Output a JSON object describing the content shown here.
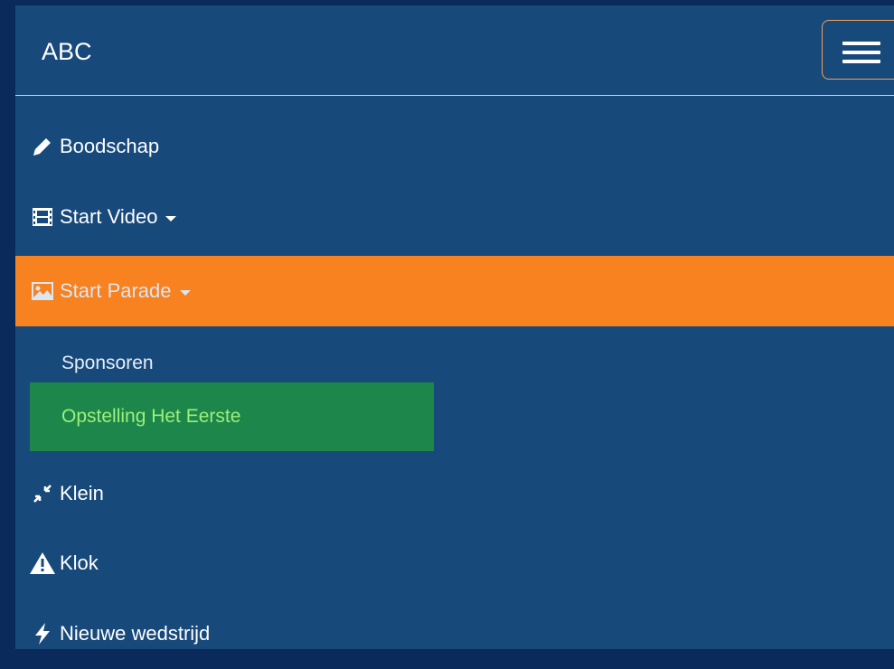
{
  "brand": {
    "title": "ABC"
  },
  "toggle": {
    "icon": "hamburger-icon"
  },
  "menu": {
    "items": [
      {
        "label": "Boodschap",
        "icon": "pencil-icon"
      },
      {
        "label": "Start Video",
        "icon": "film-icon",
        "dropdown": true
      },
      {
        "label": "Start Parade",
        "icon": "image-icon",
        "dropdown": true,
        "active": true
      },
      {
        "label": "Klein",
        "icon": "compress-icon"
      },
      {
        "label": "Klok",
        "icon": "warning-icon"
      },
      {
        "label": "Nieuwe wedstrijd",
        "icon": "flash-icon"
      }
    ],
    "submenu": [
      {
        "label": "Sponsoren"
      },
      {
        "label": "Opstelling Het Eerste",
        "highlighted": true
      }
    ]
  },
  "colors": {
    "outer_background": "#0b2a5c",
    "navbar_background": "#17497b",
    "active_item": "#f7821f",
    "highlight_item": "#1d874b",
    "highlight_text": "#9cf07a",
    "toggle_border": "#f4a25a"
  }
}
